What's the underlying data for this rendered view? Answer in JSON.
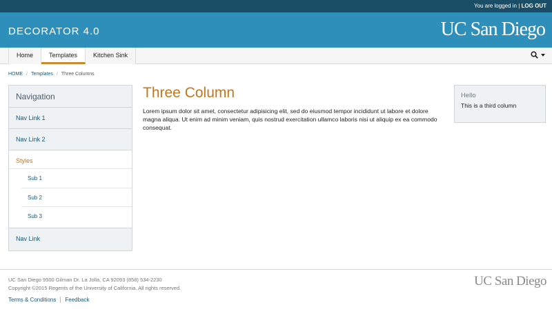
{
  "topbar": {
    "status": "You are logged in",
    "separator": "|",
    "logout": "LOG OUT"
  },
  "header": {
    "site_name": "DECORATOR 4.0",
    "logo_text": "UC San Diego"
  },
  "nav": {
    "tabs": [
      {
        "label": "Home",
        "active": false
      },
      {
        "label": "Templates",
        "active": true
      },
      {
        "label": "Kitchen Sink",
        "active": false
      }
    ],
    "search_icon": "search-icon",
    "dropdown_icon": "caret-down-icon"
  },
  "breadcrumb": {
    "items": [
      "HOME",
      "Templates",
      "Three Columns"
    ],
    "separator": "/"
  },
  "sidebar": {
    "title": "Navigation",
    "items": [
      "Nav Link 1",
      "Nav Link 2"
    ],
    "group": {
      "label": "Styles",
      "subitems": [
        "Sub 1",
        "Sub 2",
        "Sub 3"
      ]
    },
    "last_item": "Nav Link"
  },
  "main": {
    "title": "Three Column",
    "body": "Lorem ipsum dolor sit amet, consectetur adipisicing elit, sed do eiusmod tempor incididunt ut labore et dolore magna aliqua. Ut enim ad minim veniam, quis nostrud exercitation ullamco laboris nisi ut aliquip ex ea commodo consequat."
  },
  "aside": {
    "heading": "Hello",
    "text": "This is a third column"
  },
  "footer": {
    "address": "UC San Diego 9500 Gilman Dr. La Jolla, CA 92093 (858) 534-2230",
    "copyright": "Copyright ©2015 Regents of the University of California. All rights reserved.",
    "links": [
      "Terms & Conditions",
      "Feedback"
    ],
    "logo_text": "UC San Diego"
  },
  "colors": {
    "header_bg": "#2e8fba",
    "topbar_bg": "#1a4d66",
    "accent": "#c2761e",
    "link": "#1a5877"
  }
}
